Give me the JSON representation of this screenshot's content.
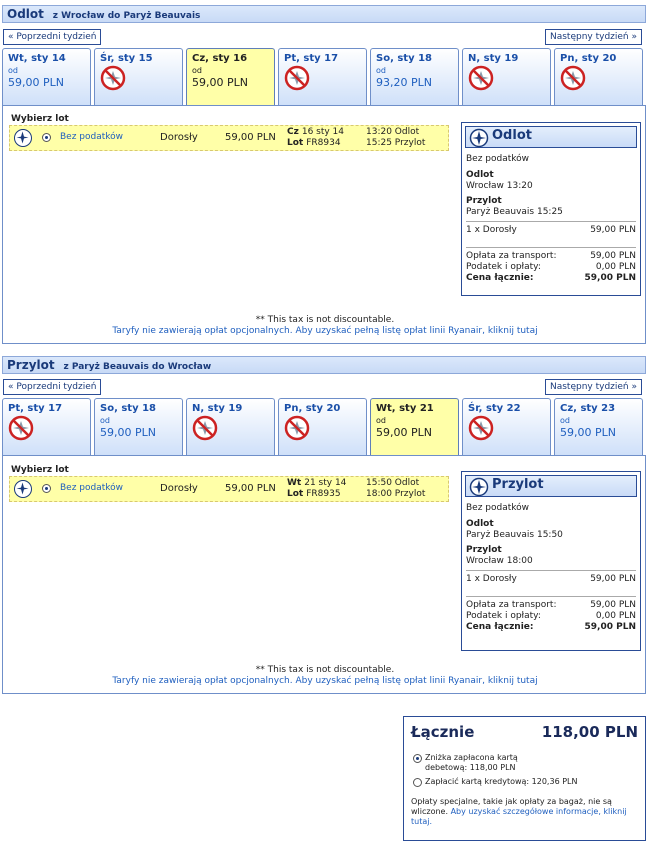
{
  "outbound": {
    "title": "Odlot",
    "route": "z Wrocław do Paryż Beauvais",
    "prev_week": "« Poprzedni tydzień",
    "next_week": "Następny tydzień »",
    "tabs": [
      {
        "date": "Wt, sty 14",
        "from": "od",
        "price": "59,00 PLN",
        "available": true,
        "selected": false
      },
      {
        "date": "Śr, sty 15",
        "available": false,
        "selected": false
      },
      {
        "date": "Cz, sty 16",
        "from": "od",
        "price": "59,00 PLN",
        "available": true,
        "selected": true
      },
      {
        "date": "Pt, sty 17",
        "available": false,
        "selected": false
      },
      {
        "date": "So, sty 18",
        "from": "od",
        "price": "93,20 PLN",
        "available": true,
        "selected": false
      },
      {
        "date": "N, sty 19",
        "available": false,
        "selected": false
      },
      {
        "date": "Pn, sty 20",
        "available": false,
        "selected": false
      }
    ],
    "choose_label": "Wybierz lot",
    "flight": {
      "fare": "Bez podatków",
      "pax": "Dorosły",
      "price": "59,00 PLN",
      "day": "Cz",
      "date": "16 sty 14",
      "lot_label": "Lot",
      "flight_no": "FR8934",
      "dep": "13:20 Odlot",
      "arr": "15:25 Przylot"
    },
    "summary": {
      "title": "Odlot",
      "fare": "Bez podatków",
      "dep_label": "Odlot",
      "dep_value": "Wrocław 13:20",
      "arr_label": "Przylot",
      "arr_value": "Paryż Beauvais 15:25",
      "pax_label": "1 x Dorosły",
      "pax_price": "59,00 PLN",
      "transport_label": "Opłata za transport:",
      "transport_value": "59,00 PLN",
      "tax_label": "Podatek i opłaty:",
      "tax_value": "0,00 PLN",
      "total_label": "Cena łącznie:",
      "total_value": "59,00 PLN"
    },
    "note": "** This tax is not discountable.",
    "note_link": "Taryfy nie zawierają opłat opcjonalnych. Aby uzyskać pełną listę opłat linii Ryanair, kliknij tutaj"
  },
  "inbound": {
    "title": "Przylot",
    "route": "z Paryż Beauvais do Wrocław",
    "prev_week": "« Poprzedni tydzień",
    "next_week": "Następny tydzień »",
    "tabs": [
      {
        "date": "Pt, sty 17",
        "available": false,
        "selected": false
      },
      {
        "date": "So, sty 18",
        "from": "od",
        "price": "59,00 PLN",
        "available": true,
        "selected": false
      },
      {
        "date": "N, sty 19",
        "available": false,
        "selected": false
      },
      {
        "date": "Pn, sty 20",
        "available": false,
        "selected": false
      },
      {
        "date": "Wt, sty 21",
        "from": "od",
        "price": "59,00 PLN",
        "available": true,
        "selected": true
      },
      {
        "date": "Śr, sty 22",
        "available": false,
        "selected": false
      },
      {
        "date": "Cz, sty 23",
        "from": "od",
        "price": "59,00 PLN",
        "available": true,
        "selected": false
      }
    ],
    "choose_label": "Wybierz lot",
    "flight": {
      "fare": "Bez podatków",
      "pax": "Dorosły",
      "price": "59,00 PLN",
      "day": "Wt",
      "date": "21 sty 14",
      "lot_label": "Lot",
      "flight_no": "FR8935",
      "dep": "15:50 Odlot",
      "arr": "18:00 Przylot"
    },
    "summary": {
      "title": "Przylot",
      "fare": "Bez podatków",
      "dep_label": "Odlot",
      "dep_value": "Paryż Beauvais 15:50",
      "arr_label": "Przylot",
      "arr_value": "Wrocław 18:00",
      "pax_label": "1 x Dorosły",
      "pax_price": "59,00 PLN",
      "transport_label": "Opłata za transport:",
      "transport_value": "59,00 PLN",
      "tax_label": "Podatek i opłaty:",
      "tax_value": "0,00 PLN",
      "total_label": "Cena łącznie:",
      "total_value": "59,00 PLN"
    },
    "note": "** This tax is not discountable.",
    "note_link": "Taryfy nie zawierają opłat opcjonalnych. Aby uzyskać pełną listę opłat linii Ryanair, kliknij tutaj"
  },
  "total": {
    "label": "Łącznie",
    "value": "118,00 PLN",
    "debit_line1": "Zniżka zapłacona kartą",
    "debit_line2": "debetową: 118,00 PLN",
    "credit": "Zapłacić kartą kredytową: 120,36 PLN",
    "note": "Opłaty specjalne, takie jak opłaty za bagaż, nie są wliczone.",
    "note_link": "Aby uzyskać szczegółowe informacje, kliknij tutaj."
  },
  "colors": {
    "accent": "#1a3a7a",
    "link": "#1f5fbf",
    "selected": "#ffffa8"
  },
  "icons": {
    "plane": "plane-icon",
    "no_flight": "no-flight-icon"
  }
}
